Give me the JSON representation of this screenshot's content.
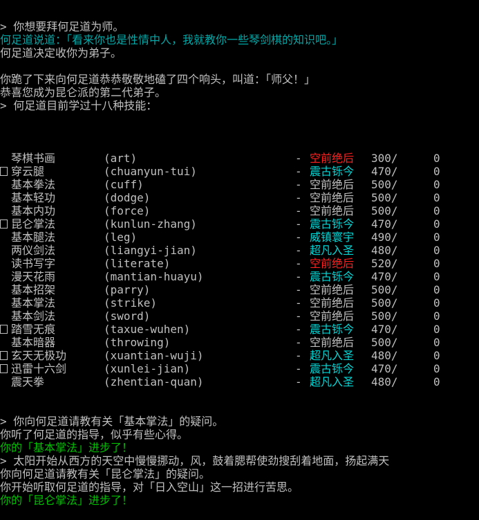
{
  "log_top": [
    {
      "text": "> 你想要拜何足道为师。",
      "color": "white"
    },
    {
      "text": "何足道说道：「看来你也是性情中人，我就教你一些琴剑棋的知识吧。」",
      "color": "cyan"
    },
    {
      "text": "何足道决定收你为弟子。",
      "color": "white"
    },
    {
      "text": "",
      "color": "white"
    },
    {
      "text": "你跪了下来向何足道恭恭敬敬地磕了四个响头，叫道：「师父！」",
      "color": "white"
    },
    {
      "text": "恭喜您成为昆仑派的第二代弟子。",
      "color": "white"
    },
    {
      "text": "> 何足道目前学过十八种技能：",
      "color": "white"
    },
    {
      "text": "",
      "color": "white"
    }
  ],
  "skills": [
    {
      "mark": false,
      "name": "琴棋书画",
      "id": "(art)",
      "rank": "空前绝后",
      "rank_color": "red",
      "level": "300/",
      "points": "0"
    },
    {
      "mark": true,
      "name": "穿云腿",
      "id": "(chuanyun-tui)",
      "rank": "震古铄今",
      "rank_color": "bcyan",
      "level": "470/",
      "points": "0"
    },
    {
      "mark": false,
      "name": "基本拳法",
      "id": "(cuff)",
      "rank": "空前绝后",
      "rank_color": "white",
      "level": "500/",
      "points": "0"
    },
    {
      "mark": false,
      "name": "基本轻功",
      "id": "(dodge)",
      "rank": "空前绝后",
      "rank_color": "white",
      "level": "500/",
      "points": "0"
    },
    {
      "mark": false,
      "name": "基本内功",
      "id": "(force)",
      "rank": "空前绝后",
      "rank_color": "white",
      "level": "500/",
      "points": "0"
    },
    {
      "mark": true,
      "name": "昆仑掌法",
      "id": "(kunlun-zhang)",
      "rank": "震古铄今",
      "rank_color": "bcyan",
      "level": "470/",
      "points": "0"
    },
    {
      "mark": false,
      "name": "基本腿法",
      "id": "(leg)",
      "rank": "威镇寰宇",
      "rank_color": "bcyan",
      "level": "490/",
      "points": "0"
    },
    {
      "mark": false,
      "name": "两仪剑法",
      "id": "(liangyi-jian)",
      "rank": "超凡入圣",
      "rank_color": "bcyan",
      "level": "480/",
      "points": "0"
    },
    {
      "mark": false,
      "name": "读书写字",
      "id": "(literate)",
      "rank": "空前绝后",
      "rank_color": "red",
      "level": "520/",
      "points": "0"
    },
    {
      "mark": false,
      "name": "漫天花雨",
      "id": "(mantian-huayu)",
      "rank": "震古铄今",
      "rank_color": "bcyan",
      "level": "470/",
      "points": "0"
    },
    {
      "mark": false,
      "name": "基本招架",
      "id": "(parry)",
      "rank": "空前绝后",
      "rank_color": "white",
      "level": "500/",
      "points": "0"
    },
    {
      "mark": false,
      "name": "基本掌法",
      "id": "(strike)",
      "rank": "空前绝后",
      "rank_color": "white",
      "level": "500/",
      "points": "0"
    },
    {
      "mark": false,
      "name": "基本剑法",
      "id": "(sword)",
      "rank": "空前绝后",
      "rank_color": "white",
      "level": "500/",
      "points": "0"
    },
    {
      "mark": true,
      "name": "踏雪无痕",
      "id": "(taxue-wuhen)",
      "rank": "震古铄今",
      "rank_color": "bcyan",
      "level": "470/",
      "points": "0"
    },
    {
      "mark": false,
      "name": "基本暗器",
      "id": "(throwing)",
      "rank": "空前绝后",
      "rank_color": "white",
      "level": "500/",
      "points": "0"
    },
    {
      "mark": true,
      "name": "玄天无极功",
      "id": "(xuantian-wuji)",
      "rank": "超凡入圣",
      "rank_color": "bcyan",
      "level": "480/",
      "points": "0"
    },
    {
      "mark": true,
      "name": "迅雷十六剑",
      "id": "(xunlei-jian)",
      "rank": "震古铄今",
      "rank_color": "bcyan",
      "level": "470/",
      "points": "0"
    },
    {
      "mark": false,
      "name": "震天拳",
      "id": "(zhentian-quan)",
      "rank": "超凡入圣",
      "rank_color": "bcyan",
      "level": "480/",
      "points": "0"
    }
  ],
  "skill_dash": "-",
  "log_bottom": [
    {
      "text": "> 你向何足道请教有关「基本掌法」的疑问。",
      "color": "white"
    },
    {
      "text": "你听了何足道的指导，似乎有些心得。",
      "color": "white"
    },
    {
      "text": "你的「基本掌法」进步了！",
      "color": "green"
    },
    {
      "text": "> 太阳开始从西方的天空中慢慢挪动，风，鼓着腮帮使劲搜刮着地面，扬起满天",
      "color": "white"
    },
    {
      "text": "你向何足道请教有关「昆仑掌法」的疑问。",
      "color": "white"
    },
    {
      "text": "你开始听取何足道的指导，对「日入空山」这一招进行苦思。",
      "color": "white"
    },
    {
      "text": "你的「昆仑掌法」进步了！",
      "color": "green"
    }
  ],
  "colors": {
    "background": "#000000",
    "white": "#c0c0c0",
    "cyan": "#00a8a8",
    "bcyan": "#00d8d8",
    "red": "#ff2020",
    "green": "#00c000"
  }
}
